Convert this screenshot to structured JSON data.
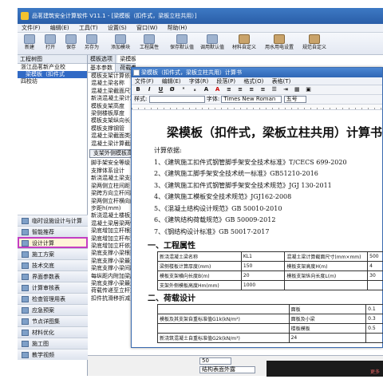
{
  "window": {
    "title": "品茗建筑安全计算软件 V11.1 - [梁模板（扣件式，梁板立柱共用）]"
  },
  "menu": [
    "文件(F)",
    "编辑(E)",
    "工具(T)",
    "设置(S)",
    "窗口(W)",
    "帮助(H)"
  ],
  "toolbar": [
    "新建",
    "打开",
    "保存",
    "另存为",
    "添加模块",
    "工程属性",
    "保存默认值",
    "调用默认值"
  ],
  "toolbar_right": [
    "材料自定义",
    "用水用电设置",
    "规范自定义"
  ],
  "left": {
    "header": "工程树图",
    "tree": [
      "浙江品茗新产业校",
      "梁模板（扣件式",
      "四校坊"
    ],
    "nav": [
      "临时设施设计与计算",
      "智能推荐",
      "设计计算",
      "施工方案",
      "技术交底",
      "界面参数表",
      "计算审核表",
      "检查管理用表",
      "应急预案",
      "节点详图集",
      "材料优化",
      "施工图",
      "教学视频"
    ],
    "active_nav": "设计计算"
  },
  "mid": {
    "tabs": [
      "模板选项",
      "梁模板（扣件式，梁板立柱共用）"
    ],
    "tabs2": [
      "基本参数",
      "荷载参数"
    ],
    "params": [
      "模板支架计算依据",
      "混凝土梁名称",
      "混凝土梁截面尺寸",
      "新浇混凝土梁计算",
      "模板支架高度",
      "梁侧楼板厚度",
      "模板支架纵向长",
      "模板支撑钢管",
      "混凝土梁截面类型",
      "混凝土梁计算截面"
    ],
    "button": "支架外侧模板高度",
    "params2": [
      "脚手架安全等级",
      "支撑体系设计",
      "新浇混凝土梁支撑",
      "梁两侧立柱间距",
      "梁跨方向立杆间距",
      "梁两侧立杆横向间距",
      "步距h(mm)",
      "新浇混凝土楼板立杆",
      "混凝土梁居梁两侧",
      "梁底增加立杆根数",
      "梁底增加立杆布置",
      "梁底增加立杆依次",
      "梁底支撑小梁根数",
      "梁底支撑小梁最大",
      "梁底支撑小梁间距",
      "每纵距内附加梁底",
      "梁底支撑小梁最大",
      "荷载传递至立杆方式",
      "扣件抗滑移折减系数"
    ]
  },
  "bottom": {
    "value": "50",
    "select": "结构表面外露"
  },
  "doc": {
    "title": "梁模板（扣件式，梁板立柱共用）计算书",
    "menu": [
      "文件(F)",
      "编辑(E)",
      "字体(R)",
      "段落(P)",
      "格式(O)",
      "表格(T)"
    ],
    "style_label": "样式:",
    "font_label": "字体:",
    "font_value": "Times New Roman",
    "font_size": "五号",
    "heading": "梁模板（扣件式，梁板立柱共用）计算书",
    "basis_title": "计算依据:",
    "basis": [
      "1、《建筑施工扣件式钢管脚手架安全技术标准》T/CECS 699-2020",
      "2、《建筑施工脚手架安全技术统一标准》GB51210-2016",
      "3、《建筑施工扣件式钢管脚手架安全技术规范》JGJ 130-2011",
      "4、《建筑施工模板安全技术规范》JGJ162-2008",
      "5、《混凝土结构设计规范》GB 50010-2010",
      "6、《建筑结构荷载规范》GB 50009-2012",
      "7、《钢结构设计标准》GB 50017-2017"
    ],
    "sec1": "一、工程属性",
    "table1": [
      [
        "新浇混凝土梁名称",
        "KL1",
        "混凝土梁计算截面尺寸(mm×mm)",
        "500"
      ],
      [
        "梁侧楼板计算厚度(mm)",
        "150",
        "模板支架高度H(m)",
        "4"
      ],
      [
        "模板支架横向长度B(m)",
        "20",
        "模板支架纵向长度L(m)",
        "30"
      ],
      [
        "支架外侧模板高度Hm(mm)",
        "1000",
        "",
        ""
      ]
    ],
    "sec2": "二、荷载设计",
    "table2": [
      [
        "",
        "面板",
        "0.1"
      ],
      [
        "模板及其支架自重标准值G1k(kN/m²)",
        "面板及小梁",
        "0.3"
      ],
      [
        "",
        "楼板模板",
        "0.5"
      ],
      [
        "新浇筑混凝土自重标准值G2k(kN/m³)",
        "24",
        ""
      ]
    ]
  },
  "status_right": "更多"
}
